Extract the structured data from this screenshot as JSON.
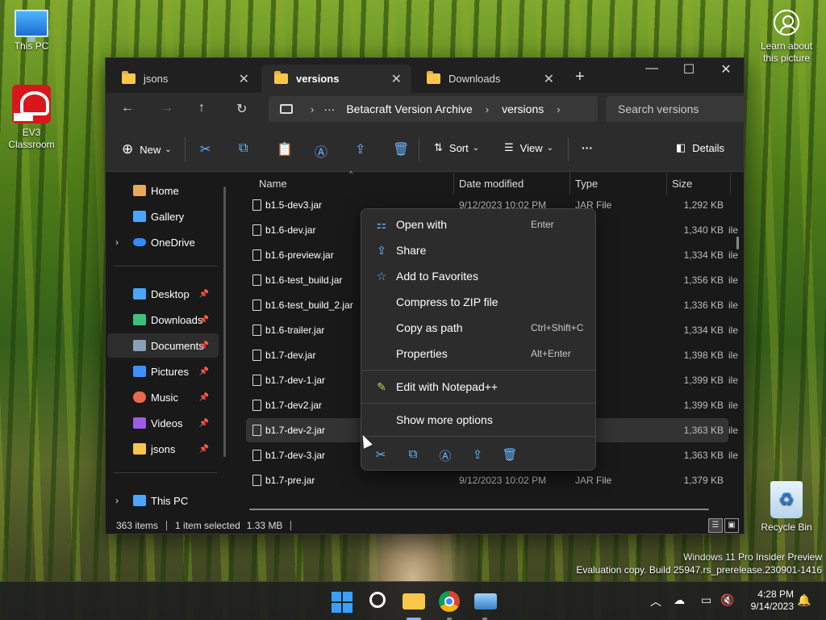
{
  "desktop": {
    "icons": [
      {
        "label": "This PC"
      },
      {
        "label": "EV3 Classroom"
      },
      {
        "label": "Recycle Bin"
      }
    ],
    "learn_about": "Learn about this picture",
    "watermark": {
      "line1": "Windows 11 Pro Insider Preview",
      "line2": "Evaluation copy. Build 25947.rs_prerelease.230901-1416"
    }
  },
  "explorer": {
    "tabs": [
      {
        "label": "jsons",
        "active": false
      },
      {
        "label": "versions",
        "active": true
      },
      {
        "label": "Downloads",
        "active": false
      }
    ],
    "address": {
      "ellipsis": "···",
      "crumbs": [
        "Betacraft Version Archive",
        "versions"
      ]
    },
    "search": {
      "placeholder": "Search versions"
    },
    "commands": {
      "new": "New",
      "sort": "Sort",
      "view": "View",
      "more": "···",
      "details": "Details"
    },
    "sidebar": {
      "items": [
        {
          "label": "Home",
          "color": "#e8a85a"
        },
        {
          "label": "Gallery",
          "color": "#4aa6ff"
        },
        {
          "label": "OneDrive",
          "color": "#2f8cff"
        },
        {
          "label": "Desktop",
          "color": "#4aa6ff"
        },
        {
          "label": "Downloads",
          "color": "#3fbf7f"
        },
        {
          "label": "Documents",
          "color": "#8aa0b8"
        },
        {
          "label": "Pictures",
          "color": "#3f8fff"
        },
        {
          "label": "Music",
          "color": "#e86a4a"
        },
        {
          "label": "Videos",
          "color": "#a05ae8"
        },
        {
          "label": "jsons",
          "color": "#f8c74a"
        },
        {
          "label": "This PC",
          "color": "#4aa6ff"
        }
      ]
    },
    "columns": {
      "name": "Name",
      "date": "Date modified",
      "type": "Type",
      "size": "Size"
    },
    "files": [
      {
        "name": "b1.5-dev3.jar",
        "date": "9/12/2023 10:02 PM",
        "type": "JAR File",
        "size": "1,292 KB"
      },
      {
        "name": "b1.6-dev.jar",
        "date": "",
        "type": "ile",
        "size": "1,340 KB"
      },
      {
        "name": "b1.6-preview.jar",
        "date": "",
        "type": "ile",
        "size": "1,334 KB"
      },
      {
        "name": "b1.6-test_build.jar",
        "date": "",
        "type": "ile",
        "size": "1,356 KB"
      },
      {
        "name": "b1.6-test_build_2.jar",
        "date": "",
        "type": "ile",
        "size": "1,336 KB"
      },
      {
        "name": "b1.6-trailer.jar",
        "date": "",
        "type": "ile",
        "size": "1,334 KB"
      },
      {
        "name": "b1.7-dev.jar",
        "date": "",
        "type": "ile",
        "size": "1,398 KB"
      },
      {
        "name": "b1.7-dev-1.jar",
        "date": "",
        "type": "ile",
        "size": "1,399 KB"
      },
      {
        "name": "b1.7-dev2.jar",
        "date": "",
        "type": "ile",
        "size": "1,399 KB"
      },
      {
        "name": "b1.7-dev-2.jar",
        "date": "",
        "type": "ile",
        "size": "1,363 KB"
      },
      {
        "name": "b1.7-dev-3.jar",
        "date": "",
        "type": "ile",
        "size": "1,363 KB"
      },
      {
        "name": "b1.7-pre.jar",
        "date": "9/12/2023 10:02 PM",
        "type": "JAR File",
        "size": "1,379 KB"
      }
    ],
    "status": {
      "count": "363 items",
      "selected": "1 item selected",
      "size": "1.33 MB"
    }
  },
  "context_menu": {
    "items": [
      {
        "label": "Open with",
        "accel": "Enter"
      },
      {
        "label": "Share",
        "accel": ""
      },
      {
        "label": "Add to Favorites",
        "accel": ""
      },
      {
        "label": "Compress to ZIP file",
        "accel": ""
      },
      {
        "label": "Copy as path",
        "accel": "Ctrl+Shift+C"
      },
      {
        "label": "Properties",
        "accel": "Alt+Enter"
      },
      {
        "label": "Edit with Notepad++",
        "accel": ""
      },
      {
        "label": "Show more options",
        "accel": ""
      }
    ]
  },
  "taskbar": {
    "time": "4:28 PM",
    "date": "9/14/2023"
  }
}
